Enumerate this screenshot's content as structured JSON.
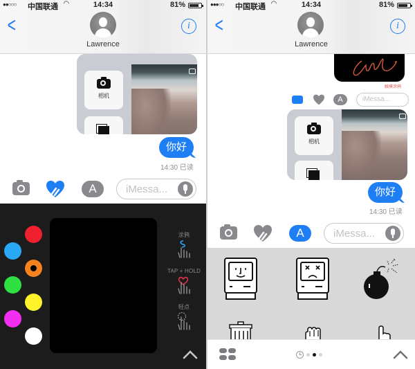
{
  "status_bar": {
    "signal": "●●○○○",
    "signal_right": "●●●○○",
    "carrier": "中国联通",
    "wifi_icon": "wifi-icon",
    "time": "14:34",
    "battery_percent": "81%"
  },
  "nav": {
    "back_icon": "chevron-left-icon",
    "contact_name": "Lawrence",
    "info_icon": "info-icon",
    "info_glyph": "i"
  },
  "left_screen": {
    "photo_picker": {
      "camera_label": "相机"
    },
    "message": {
      "text": "你好",
      "receipt": "14:30 已读"
    },
    "drawer": {
      "camera_icon": "camera-icon",
      "digital_touch_icon": "digital-touch-heart-icon",
      "digital_touch_active": true,
      "app_store_icon": "app-store-icon",
      "app_store_glyph": "A",
      "input_placeholder": "iMessa...",
      "mic_icon": "microphone-icon"
    },
    "digital_touch": {
      "colors": [
        {
          "name": "red",
          "hex": "#f0202e",
          "selected": false
        },
        {
          "name": "blue",
          "hex": "#2aa8f5",
          "selected": false
        },
        {
          "name": "orange",
          "hex": "#f5821f",
          "selected": true
        },
        {
          "name": "green",
          "hex": "#2ee042",
          "selected": false
        },
        {
          "name": "yellow",
          "hex": "#fff22a",
          "selected": false
        },
        {
          "name": "magenta",
          "hex": "#f22ef0",
          "selected": false
        },
        {
          "name": "white",
          "hex": "#ffffff",
          "selected": false
        }
      ],
      "hints": [
        {
          "label": "涂鸦",
          "icon": "sketch-gesture-icon"
        },
        {
          "label": "TAP + HOLD",
          "icon": "heartbeat-gesture-icon"
        },
        {
          "label": "轻点",
          "icon": "tap-gesture-icon"
        }
      ],
      "expand_icon": "chevron-up-icon"
    }
  },
  "right_screen": {
    "doodle_caption": "触摸涂鸦",
    "mini_drawer": {
      "input_placeholder": "iMessa..."
    },
    "photo_picker": {
      "camera_label": "相机"
    },
    "message": {
      "text": "你好",
      "receipt": "14:30 已读"
    },
    "drawer": {
      "camera_icon": "camera-icon",
      "digital_touch_icon": "digital-touch-heart-icon",
      "app_store_icon": "app-store-icon",
      "app_store_glyph": "A",
      "app_store_active": true,
      "input_placeholder": "iMessa...",
      "mic_icon": "microphone-icon"
    },
    "stickers": [
      {
        "name": "happy-mac-sticker"
      },
      {
        "name": "sad-mac-sticker"
      },
      {
        "name": "bomb-sticker"
      },
      {
        "name": "trash-can-sticker"
      },
      {
        "name": "grab-hand-sticker"
      },
      {
        "name": "pointer-hand-sticker"
      }
    ],
    "bottom_bar": {
      "apps_icon": "app-drawer-icon",
      "recent_icon": "recents-clock-icon",
      "pages": 3,
      "active_page": 2,
      "expand_icon": "chevron-up-icon"
    }
  },
  "colors": {
    "accent": "#1e7ff5",
    "touch_panel_bg": "#1c1c1c",
    "sticker_panel_bg": "#d8d8d8"
  }
}
